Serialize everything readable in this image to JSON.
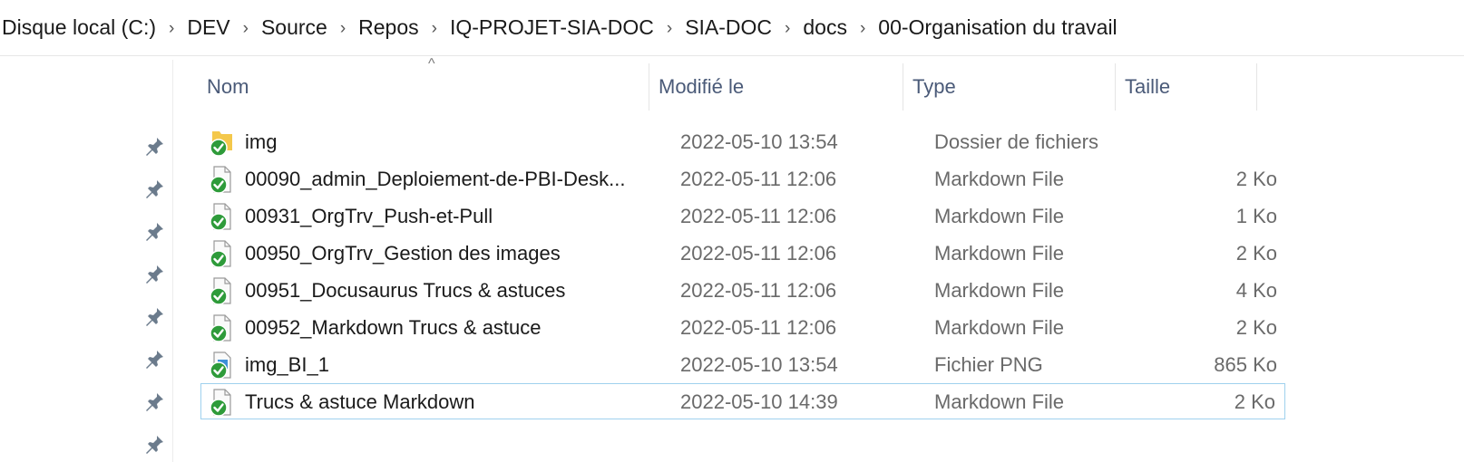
{
  "breadcrumb": [
    "Disque local (C:)",
    "DEV",
    "Source",
    "Repos",
    "IQ-PROJET-SIA-DOC",
    "SIA-DOC",
    "docs",
    "00-Organisation du travail"
  ],
  "columns": {
    "name": "Nom",
    "modified": "Modifié le",
    "type": "Type",
    "size": "Taille"
  },
  "files": [
    {
      "name": "img",
      "modified": "2022-05-10 13:54",
      "type": "Dossier de fichiers",
      "size": "",
      "icon": "folder-icon"
    },
    {
      "name": "00090_admin_Deploiement-de-PBI-Desk...",
      "modified": "2022-05-11 12:06",
      "type": "Markdown File",
      "size": "2 Ko",
      "icon": "file-icon"
    },
    {
      "name": "00931_OrgTrv_Push-et-Pull",
      "modified": "2022-05-11 12:06",
      "type": "Markdown File",
      "size": "1 Ko",
      "icon": "file-icon"
    },
    {
      "name": "00950_OrgTrv_Gestion des images",
      "modified": "2022-05-11 12:06",
      "type": "Markdown File",
      "size": "2 Ko",
      "icon": "file-icon"
    },
    {
      "name": "00951_Docusaurus Trucs & astuces",
      "modified": "2022-05-11 12:06",
      "type": "Markdown File",
      "size": "4 Ko",
      "icon": "file-icon"
    },
    {
      "name": "00952_Markdown Trucs & astuce",
      "modified": "2022-05-11 12:06",
      "type": "Markdown File",
      "size": "2 Ko",
      "icon": "file-icon"
    },
    {
      "name": "img_BI_1",
      "modified": "2022-05-10 13:54",
      "type": "Fichier PNG",
      "size": "865 Ko",
      "icon": "image-file-icon"
    },
    {
      "name": "Trucs & astuce Markdown",
      "modified": "2022-05-10 14:39",
      "type": "Markdown File",
      "size": "2 Ko",
      "icon": "file-icon",
      "selected": true
    }
  ],
  "colors": {
    "sync_green": "#2e9b3a",
    "header_text": "#4a5a78",
    "selection_border": "#9fd1ee"
  }
}
